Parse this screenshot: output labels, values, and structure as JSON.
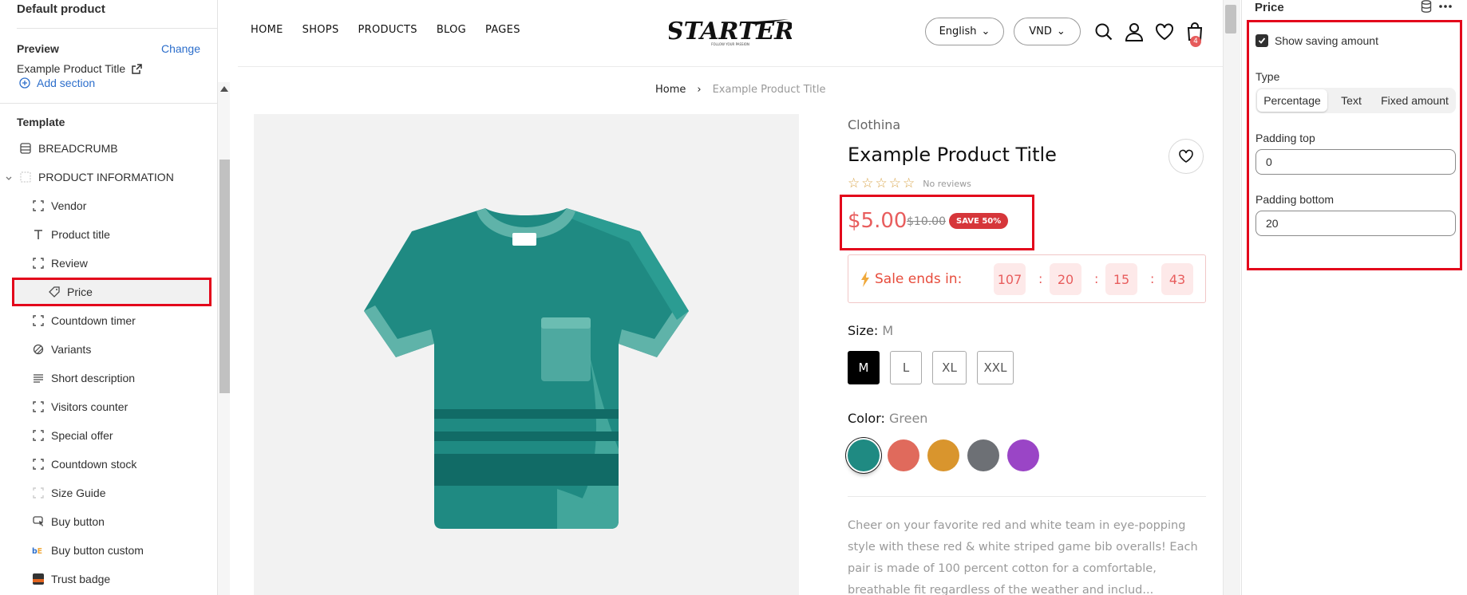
{
  "left_panel": {
    "title": "Default product",
    "preview_label": "Preview",
    "change_link": "Change",
    "preview_value": "Example Product Title",
    "add_section": "Add section",
    "template_label": "Template",
    "tree": [
      {
        "label": "BREADCRUMB",
        "icon": "layout-icon"
      },
      {
        "label": "PRODUCT INFORMATION",
        "icon": "section-icon"
      },
      {
        "label": "Vendor",
        "icon": "block-icon"
      },
      {
        "label": "Product title",
        "icon": "text-icon"
      },
      {
        "label": "Review",
        "icon": "block-icon"
      },
      {
        "label": "Price",
        "icon": "price-tag-icon"
      },
      {
        "label": "Countdown timer",
        "icon": "block-icon"
      },
      {
        "label": "Variants",
        "icon": "variants-icon"
      },
      {
        "label": "Short description",
        "icon": "paragraph-icon"
      },
      {
        "label": "Visitors counter",
        "icon": "block-icon"
      },
      {
        "label": "Special offer",
        "icon": "block-icon"
      },
      {
        "label": "Countdown stock",
        "icon": "block-icon"
      },
      {
        "label": "Size Guide",
        "icon": "block-faded-icon"
      },
      {
        "label": "Buy button",
        "icon": "cursor-icon"
      },
      {
        "label": "Buy button custom",
        "icon": "app-icon"
      },
      {
        "label": "Trust badge",
        "icon": "badge-image-icon"
      }
    ]
  },
  "store": {
    "nav": [
      "HOME",
      "SHOPS",
      "PRODUCTS",
      "BLOG",
      "PAGES"
    ],
    "logo_text": "STARTER",
    "logo_tagline": "FOLLOW YOUR PASSION",
    "language": "English",
    "currency": "VND",
    "cart_count": "4",
    "breadcrumb": {
      "home": "Home",
      "sep": "›",
      "current": "Example Product Title"
    },
    "vendor": "Clothina",
    "title": "Example Product Title",
    "no_reviews": "No reviews",
    "price": "$5.00",
    "compare_price": "$10.00",
    "save_badge": "SAVE 50%",
    "sale_label": "Sale ends in:",
    "timer": [
      "107",
      "20",
      "15",
      "43"
    ],
    "size_label": "Size:",
    "size_value": "M",
    "sizes": [
      "M",
      "L",
      "XL",
      "XXL"
    ],
    "color_label": "Color:",
    "color_value": "Green",
    "swatches": [
      "#1f8a82",
      "#e06a5c",
      "#d9952d",
      "#6d7075",
      "#9a45c6"
    ],
    "description": "Cheer on your favorite red and white team in eye-popping style with these red & white striped game bib overalls! Each pair is made of 100 percent cotton for a comfortable, breathable fit regardless of the weather and includ..."
  },
  "right_panel": {
    "title": "Price",
    "show_saving": "Show saving amount",
    "type_label": "Type",
    "type_options": [
      "Percentage",
      "Text",
      "Fixed amount"
    ],
    "padding_top_label": "Padding top",
    "padding_top": "0",
    "padding_bottom_label": "Padding bottom",
    "padding_bottom": "20"
  },
  "colors": {
    "highlight": "#e3051b",
    "link": "#2c6ecb",
    "sale": "#e85d5d",
    "tshirt": "#1f8a82"
  }
}
